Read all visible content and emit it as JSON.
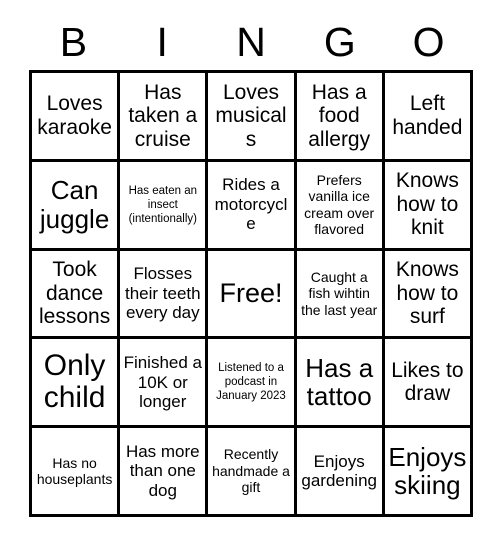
{
  "card": {
    "title": "BINGO",
    "header_letters": [
      "B",
      "I",
      "N",
      "G",
      "O"
    ],
    "columns": 5,
    "rows": 5,
    "colors": {
      "background": "#ffffff",
      "grid_line": "#000000",
      "text": "#000000"
    },
    "cells": [
      {
        "text": "Loves karaoke",
        "size": "lg",
        "free": false
      },
      {
        "text": "Has taken a cruise",
        "size": "lg",
        "free": false
      },
      {
        "text": "Loves musicals",
        "size": "lg",
        "free": false
      },
      {
        "text": "Has a food allergy",
        "size": "lg",
        "free": false
      },
      {
        "text": "Left handed",
        "size": "lg",
        "free": false
      },
      {
        "text": "Can juggle",
        "size": "xl",
        "free": false
      },
      {
        "text": "Has eaten an insect (intentionally)",
        "size": "xs",
        "free": false
      },
      {
        "text": "Rides a motorcycle",
        "size": "md",
        "free": false
      },
      {
        "text": "Prefers vanilla ice cream over flavored",
        "size": "sm",
        "free": false
      },
      {
        "text": "Knows how to knit",
        "size": "lg",
        "free": false
      },
      {
        "text": "Took dance lessons",
        "size": "lg",
        "free": false
      },
      {
        "text": "Flosses their teeth every day",
        "size": "md",
        "free": false
      },
      {
        "text": "Free!",
        "size": "free",
        "free": true
      },
      {
        "text": "Caught a fish wihtin the last year",
        "size": "sm",
        "free": false
      },
      {
        "text": "Knows how to surf",
        "size": "lg",
        "free": false
      },
      {
        "text": "Only child",
        "size": "xxl",
        "free": false
      },
      {
        "text": "Finished a 10K or longer",
        "size": "md",
        "free": false
      },
      {
        "text": "Listened to a podcast in January 2023",
        "size": "xs",
        "free": false
      },
      {
        "text": "Has a tattoo",
        "size": "xl",
        "free": false
      },
      {
        "text": "Likes to draw",
        "size": "lg",
        "free": false
      },
      {
        "text": "Has no houseplants",
        "size": "sm",
        "free": false
      },
      {
        "text": "Has more than one dog",
        "size": "md",
        "free": false
      },
      {
        "text": "Recently handmade a gift",
        "size": "sm",
        "free": false
      },
      {
        "text": "Enjoys gardening",
        "size": "md",
        "free": false
      },
      {
        "text": "Enjoys skiing",
        "size": "xl",
        "free": false
      }
    ]
  }
}
